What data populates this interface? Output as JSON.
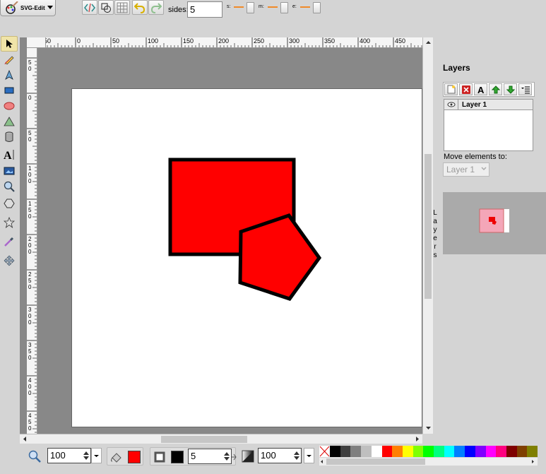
{
  "app": {
    "logo_text": "SVG-Edit"
  },
  "toolbar": {
    "sides_label": "sides:",
    "sides_value": "5",
    "s_label": "s:",
    "m_label": "m:",
    "e_label": "e:"
  },
  "ruler_h": [
    "-50",
    "0",
    "50",
    "100",
    "150",
    "200",
    "250",
    "300",
    "350",
    "400",
    "450"
  ],
  "ruler_v": [
    "50",
    "0",
    "50",
    "100",
    "150",
    "200",
    "250",
    "300",
    "350",
    "400",
    "450"
  ],
  "layers": {
    "title": "Layers",
    "items": [
      {
        "name": "Layer 1",
        "visible": true
      }
    ],
    "move_label": "Move elements to:",
    "move_selected": "Layer 1",
    "side_tab": "Layers"
  },
  "bottom": {
    "zoom_value": "100",
    "stroke_width": "5",
    "opacity_value": "100",
    "fill_color": "#ff0000",
    "stroke_color": "#000000"
  },
  "palette": [
    "none",
    "#000000",
    "#3f3f3f",
    "#7f7f7f",
    "#bfbfbf",
    "#ffffff",
    "#ff0000",
    "#ff7f00",
    "#ffff00",
    "#7fff00",
    "#00ff00",
    "#00ff7f",
    "#00ffff",
    "#007fff",
    "#0000ff",
    "#7f00ff",
    "#ff00ff",
    "#ff007f",
    "#7f0000",
    "#7f3f00",
    "#7f7f00"
  ],
  "shapes": {
    "rect_fill": "#ff0000",
    "pentagon_fill": "#ff0000",
    "stroke": "#000000"
  }
}
